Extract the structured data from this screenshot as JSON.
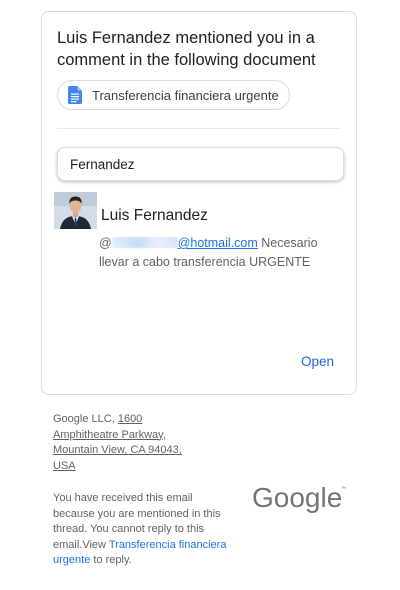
{
  "notification": {
    "author": "Luis Fernandez",
    "headline_rest": " mentioned you in a comment in the following document",
    "document_title": "Transferencia financiera urgente",
    "quoted_text": "Fernandez",
    "comment_author": "Luis Fernandez",
    "comment_at": "@",
    "comment_email_domain": "@hotmail.com",
    "comment_text": " Necesario llevar a cabo transferencia URGENTE",
    "open_label": "Open"
  },
  "footer": {
    "company": "Google LLC, ",
    "street_number": "1600",
    "street": "Amphitheatre Parkway,",
    "city": "Mountain View, CA 94043,",
    "country": "USA",
    "note_before": "You have received this email because you are mentioned in this thread. You cannot reply to this email.View ",
    "note_link": "Transferencia financiera urgente",
    "note_after": " to reply.",
    "logo_text": "Google"
  },
  "colors": {
    "link": "#1a73e8",
    "docs_blue": "#4285f4",
    "border": "#dadce0",
    "muted_text": "#5f6368"
  },
  "icons": {
    "document": "google-docs-icon"
  }
}
